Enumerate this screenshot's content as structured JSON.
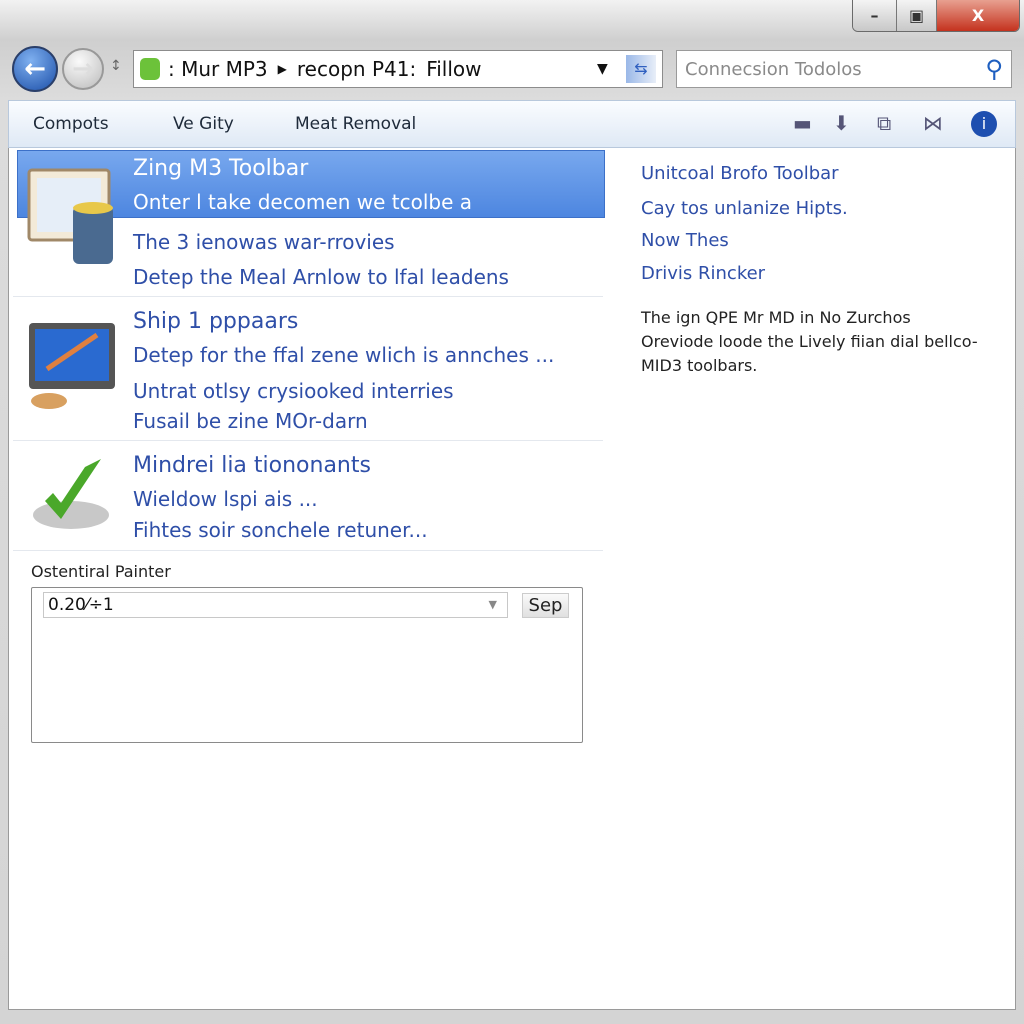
{
  "window": {
    "controls": {
      "minimize": "–",
      "maximize": "▣",
      "close": "X"
    }
  },
  "nav": {
    "address": {
      "crumbs": [
        ": Mur MP3",
        "recopn P41:",
        "Fillow"
      ]
    },
    "search": {
      "placeholder": "Connecsion Todolos"
    }
  },
  "command_bar": {
    "items": [
      "Compots",
      "Ve Gity",
      "Meat Removal"
    ]
  },
  "list": [
    {
      "title": "Zing M3 Toolbar",
      "lines": [
        "Onter l take decomen we tcolbe a",
        "The 3  ienowas war-rrovies",
        "Detep the Meal Arnlow to lfal leadens"
      ],
      "selected": true
    },
    {
      "title": "Ship 1 pppaars",
      "lines": [
        "Detep for the ffal zene wlich is annches ...",
        "Untrat otlsy crysiooked interries",
        "Fusail be zine MOr-darn"
      ]
    },
    {
      "title": "Mindrei lia tiononants",
      "lines": [
        "Wieldow lspi ais ...",
        "Fihtes soir sonchele retuner..."
      ]
    }
  ],
  "right_pane": {
    "links": [
      "Unitcoal Brofo Toolbar",
      "Cay tos unlanize Hipts.",
      "Now Thes",
      "Drivis Rincker"
    ],
    "description": [
      "The ign QPE Mr MD in No Zurchos",
      "Oreviode loode the Lively fiian dial bellco-",
      "MID3 toolbars."
    ]
  },
  "panel": {
    "label": "Ostentiral Painter",
    "combo_value": "0.20⁄÷1",
    "button": "Sep"
  },
  "colors": {
    "selection": "#4d86e0",
    "link": "#2f4fa8"
  }
}
